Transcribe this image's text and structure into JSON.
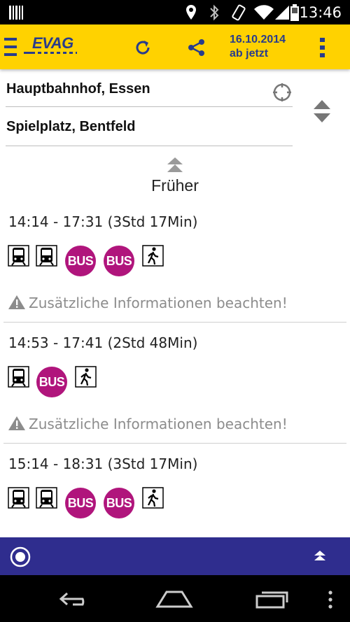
{
  "status_bar": {
    "time": "13:46"
  },
  "app_bar": {
    "logo_text": "EVAG",
    "date": "16.10.2014",
    "time_mode": "ab jetzt"
  },
  "search": {
    "from": "Hauptbahnhof, Essen",
    "to": "Spielplatz, Bentfeld"
  },
  "earlier_label": "Früher",
  "trips": [
    {
      "time": "14:14 - 17:31 (3Std 17Min)",
      "legs": [
        "tram",
        "tram",
        "bus",
        "bus",
        "walk"
      ],
      "warning": "Zusätzliche Informationen beachten!"
    },
    {
      "time": "14:53 - 17:41 (2Std 48Min)",
      "legs": [
        "tram",
        "bus",
        "walk"
      ],
      "warning": "Zusätzliche Informationen beachten!"
    },
    {
      "time": "15:14 - 18:31 (3Std 17Min)",
      "legs": [
        "tram",
        "tram",
        "bus",
        "bus",
        "walk"
      ]
    }
  ],
  "bus_label": "BUS",
  "colors": {
    "appbar": "#ffd200",
    "brand_blue": "#283c8c",
    "bus": "#b0157c",
    "bottombar": "#2f2d8e"
  },
  "icons": [
    "menu-icon",
    "refresh-icon",
    "share-icon",
    "overflow-menu-icon",
    "locate-icon",
    "swap-icon",
    "earlier-arrow-icon",
    "tram-icon",
    "bus-icon",
    "walk-icon",
    "warning-icon",
    "radio-icon",
    "collapse-icon",
    "back-icon",
    "home-icon",
    "recents-icon"
  ]
}
